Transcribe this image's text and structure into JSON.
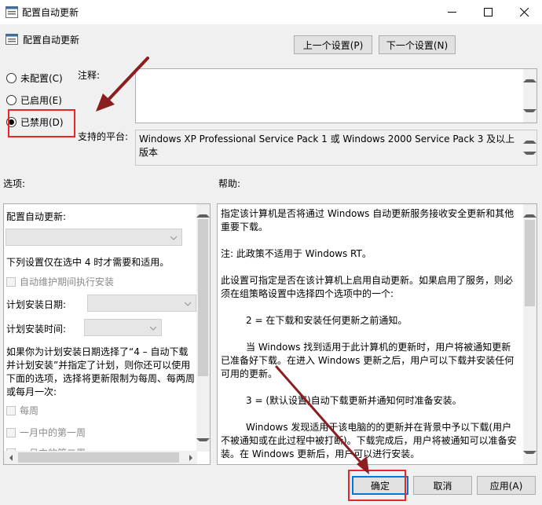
{
  "window": {
    "title": "配置自动更新"
  },
  "header": {
    "policy_name": "配置自动更新",
    "prev_button": "上一个设置(P)",
    "next_button": "下一个设置(N)"
  },
  "state": {
    "options": [
      {
        "label": "未配置(C)",
        "checked": false
      },
      {
        "label": "已启用(E)",
        "checked": false
      },
      {
        "label": "已禁用(D)",
        "checked": true
      }
    ]
  },
  "comment": {
    "label": "注释:",
    "value": ""
  },
  "platform": {
    "label": "支持的平台:",
    "value": "Windows XP Professional Service Pack 1 或 Windows 2000 Service Pack 3 及以上版本"
  },
  "options_pane": {
    "label": "选项:",
    "configure_label": "配置自动更新:",
    "configure_value": "",
    "note": "下列设置仅在选中 4 时才需要和适用。",
    "maintenance_check": "自动维护期间执行安装",
    "schedule_day_label": "计划安装日期:",
    "schedule_day_value": "",
    "schedule_time_label": "计划安装时间:",
    "schedule_time_value": "",
    "explain": [
      "如果你为计划安装日期选择了“4 – 自动下载",
      "并计划安装”并指定了计划，则你还可以使用",
      "下面的选项，选择将更新限制为每周、每两周",
      "或每月一次:"
    ],
    "checks": [
      "每周",
      "一月中的第一周",
      "一月中的第二周"
    ]
  },
  "help_pane": {
    "label": "帮助:",
    "paragraphs": [
      {
        "text": "指定该计算机是否将通过 Windows 自动更新服务接收安全更新和其他重要下载。",
        "indent": false
      },
      {
        "text": "注: 此政策不适用于 Windows RT。",
        "indent": false
      },
      {
        "text": "此设置可指定是否在该计算机上启用自动更新。如果启用了服务，则必须在组策略设置中选择四个选项中的一个:",
        "indent": false
      },
      {
        "text": "2 = 在下载和安装任何更新之前通知。",
        "indent": true
      },
      {
        "text": "当 Windows 找到适用于此计算机的更新时，用户将被通知更新已准备好下载。在进入 Windows 更新之后，用户可以下载并安装任何可用的更新。",
        "indent": true
      },
      {
        "text": "3 = (默认设置)自动下载更新并通知何时准备安装。",
        "indent": true
      },
      {
        "text": "Windows 发现适用于该电脑的的更新并在背景中予以下载(用户不被通知或在此过程中被打断)。下载完成后，用户将被通知可以准备安装。在 Windows 更新后，用户可以进行安装。",
        "indent": true
      }
    ]
  },
  "footer": {
    "ok": "确定",
    "cancel": "取消",
    "apply": "应用(A)"
  },
  "colors": {
    "annotation": "#e8262a",
    "arrow": "#8b1e1e",
    "accent": "#0078d7"
  }
}
